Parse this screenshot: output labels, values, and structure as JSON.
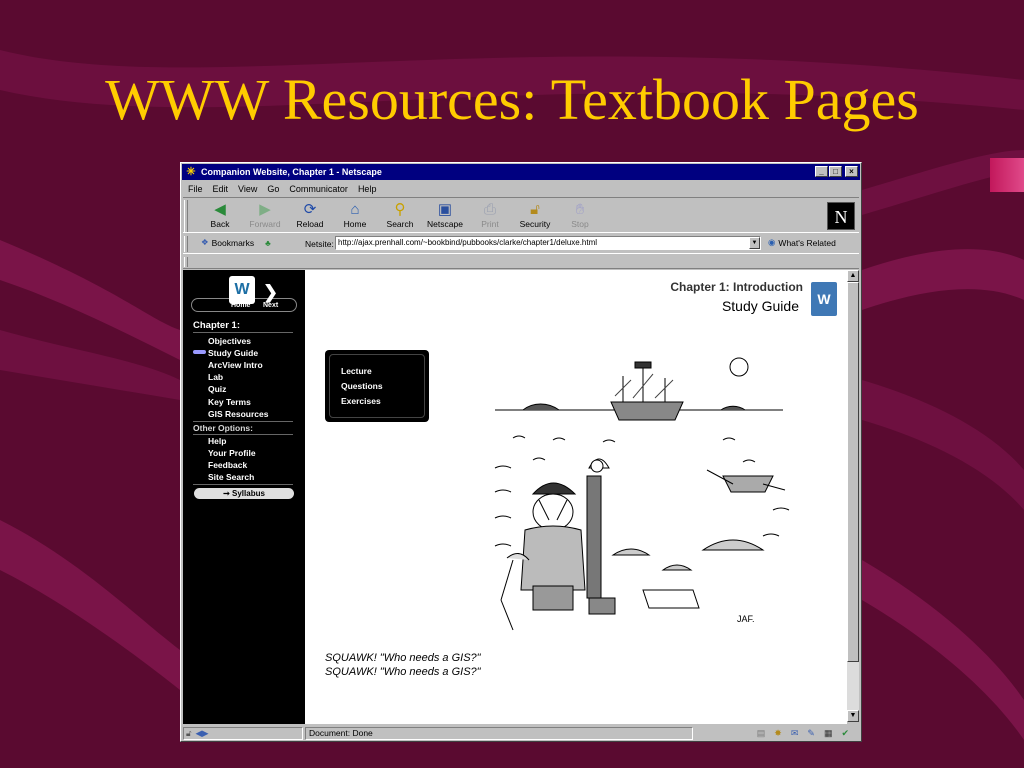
{
  "slide": {
    "title": "WWW Resources: Textbook Pages"
  },
  "window": {
    "title": "Companion Website, Chapter 1 - Netscape",
    "controls": [
      "_",
      "□",
      "×"
    ]
  },
  "menubar": [
    "File",
    "Edit",
    "View",
    "Go",
    "Communicator",
    "Help"
  ],
  "toolbar": {
    "buttons": [
      {
        "label": "Back",
        "icon": "back-arrow-icon",
        "enabled": true
      },
      {
        "label": "Forward",
        "icon": "forward-arrow-icon",
        "enabled": false
      },
      {
        "label": "Reload",
        "icon": "reload-icon",
        "enabled": true
      },
      {
        "label": "Home",
        "icon": "home-icon",
        "enabled": true
      },
      {
        "label": "Search",
        "icon": "search-icon",
        "enabled": true
      },
      {
        "label": "Netscape",
        "icon": "netscape-icon",
        "enabled": true
      },
      {
        "label": "Print",
        "icon": "print-icon",
        "enabled": false
      },
      {
        "label": "Security",
        "icon": "lock-icon",
        "enabled": true
      },
      {
        "label": "Stop",
        "icon": "stop-icon",
        "enabled": false
      }
    ],
    "logo_letter": "N"
  },
  "location": {
    "bookmarks_label": "Bookmarks",
    "netsite_label": "Netsite:",
    "url": "http://ajax.prenhall.com/~bookbind/pubbooks/clarke/chapter1/deluxe.html",
    "related_label": "What's Related"
  },
  "sidebar": {
    "logo_home": "Home",
    "logo_next": "Next",
    "chapter_heading": "Chapter 1:",
    "chapter_links": [
      "Objectives",
      "Study Guide",
      "ArcView Intro",
      "Lab",
      "Quiz",
      "Key Terms",
      "GIS Resources"
    ],
    "current_link": "Study Guide",
    "other_heading": "Other Options:",
    "other_links": [
      "Help",
      "Your Profile",
      "Feedback",
      "Site Search"
    ],
    "syllabus_label": "Syllabus"
  },
  "main": {
    "chapter_title": "Chapter 1: Introduction",
    "chapter_subtitle": "Study Guide",
    "menu_links": [
      "Lecture",
      "Questions",
      "Exercises"
    ],
    "captions": [
      "SQUAWK! \"Who needs a GIS?\"",
      "SQUAWK! \"Who needs a GIS?\""
    ],
    "cartoon_signature": "JAF."
  },
  "statusbar": {
    "text": "Document: Done"
  },
  "colors": {
    "slide_background": "#5a0a30",
    "slide_title": "#ffcc00",
    "titlebar": "#000080",
    "chrome": "#c0c0c0",
    "sidebar_background": "#000000"
  }
}
